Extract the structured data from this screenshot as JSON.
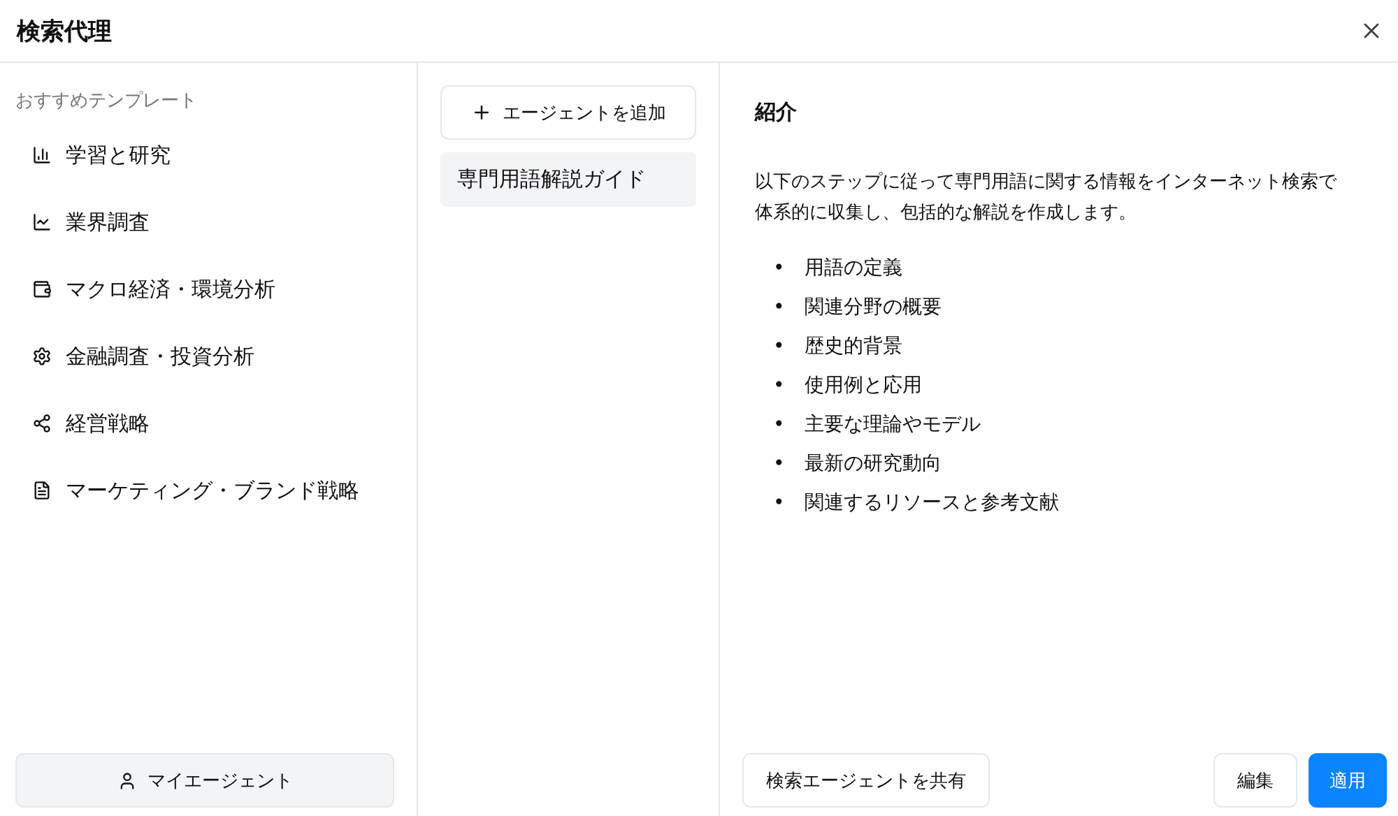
{
  "window": {
    "title": "検索代理"
  },
  "sidebar": {
    "heading": "おすすめテンプレート",
    "items": [
      {
        "label": "学習と研究",
        "kind": "bar-chart"
      },
      {
        "label": "業界調査",
        "kind": "line-chart"
      },
      {
        "label": "マクロ経済・環境分析",
        "kind": "wallet"
      },
      {
        "label": "金融調査・投資分析",
        "kind": "gear"
      },
      {
        "label": "経営戦略",
        "kind": "share"
      },
      {
        "label": "マーケティング・ブランド戦略",
        "kind": "document"
      }
    ],
    "my_agents_button": "マイエージェント"
  },
  "agents": {
    "add_button": "エージェントを追加",
    "items": [
      {
        "label": "専門用語解説ガイド",
        "selected": true
      }
    ]
  },
  "detail": {
    "heading": "紹介",
    "description": "以下のステップに従って専門用語に関する情報をインターネット検索で体系的に収集し、包括的な解説を作成します。",
    "steps": [
      {
        "marker": "•",
        "text": "用語の定義"
      },
      {
        "marker": "•",
        "text": "関連分野の概要"
      },
      {
        "marker": "•",
        "text": "歴史的背景"
      },
      {
        "marker": "•",
        "text": "使用例と応用"
      },
      {
        "marker": "•",
        "text": "主要な理論やモデル"
      },
      {
        "marker": "•",
        "text": "最新の研究動向"
      },
      {
        "marker": "•",
        "text": "関連するリソースと参考文献"
      }
    ]
  },
  "footer": {
    "share_button": "検索エージェントを共有",
    "edit_button": "編集",
    "apply_button": "適用"
  }
}
